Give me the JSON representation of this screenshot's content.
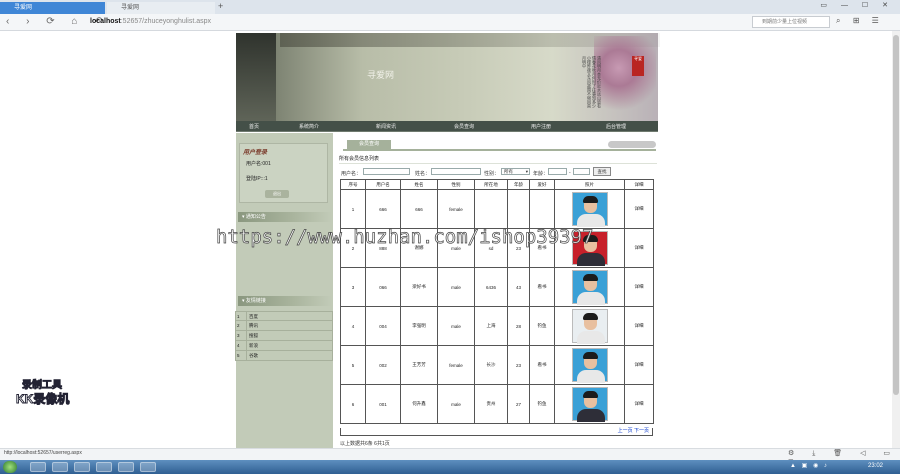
{
  "browser": {
    "tabs": [
      {
        "label": "寻爱网",
        "active": true
      },
      {
        "label": "寻爱网",
        "active": false
      }
    ],
    "new_tab_glyph": "+",
    "window_buttons": "▭ — ☐ ✕",
    "nav_glyphs": "‹ › ⟳ ⌂ ↶",
    "url_host": "localhost",
    "url_path": ":52657/zhuceyonghulist.aspx",
    "search_placeholder": "到期前少量上位视频",
    "right_icons": "⌕ ⊞ ☰"
  },
  "site": {
    "title": "寻爱网",
    "poem": "清风明月本无价近水远山皆有情春花秋月何时了往事知多少小楼昨夜又东风故国不堪回首月明中",
    "seal": "寻爱",
    "nav": [
      "首页",
      "系统简介",
      "新闻资讯",
      "会员查询",
      "用户注册",
      "后台管理"
    ]
  },
  "sidebar": {
    "login_title": "用户登录",
    "user_line": "用户名:001",
    "ip_line": "登陆IP:::1",
    "logout_label": "退出",
    "notice_head": "通知公告",
    "links_head": "友情链接",
    "links": [
      {
        "n": "1",
        "t": "百度"
      },
      {
        "n": "2",
        "t": "腾讯"
      },
      {
        "n": "3",
        "t": "搜狐"
      },
      {
        "n": "4",
        "t": "新浪"
      },
      {
        "n": "5",
        "t": "谷歌"
      }
    ]
  },
  "main": {
    "tab_label": "会员查询",
    "list_title": "所有会员信息列表",
    "filter": {
      "username_label": "用户名：",
      "name_label": "姓名：",
      "sex_label": "性别：",
      "sex_value": "所有",
      "age_label": "年龄：",
      "age_sep": "-",
      "search_label": "查找"
    },
    "columns": [
      "序号",
      "用户名",
      "姓名",
      "性别",
      "所在地",
      "年龄",
      "爱好",
      "照片",
      "详细"
    ],
    "rows": [
      {
        "no": "1",
        "user": "666",
        "name": "666",
        "sex": "female",
        "loc": "",
        "age": "",
        "hobby": "",
        "detail": "详细"
      },
      {
        "no": "2",
        "user": "888",
        "name": "谢娜",
        "sex": "male",
        "loc": "sd",
        "age": "23",
        "hobby": "看书",
        "detail": "详细"
      },
      {
        "no": "3",
        "user": "066",
        "name": "梁好书",
        "sex": "male",
        "loc": "6436",
        "age": "43",
        "hobby": "看书",
        "detail": "详细"
      },
      {
        "no": "4",
        "user": "004",
        "name": "李强明",
        "sex": "male",
        "loc": "上海",
        "age": "28",
        "hobby": "钓鱼",
        "detail": "详细"
      },
      {
        "no": "5",
        "user": "002",
        "name": "王芳芳",
        "sex": "female",
        "loc": "长沙",
        "age": "23",
        "hobby": "看书",
        "detail": "详细"
      },
      {
        "no": "6",
        "user": "001",
        "name": "何升鑫",
        "sex": "male",
        "loc": "贵州",
        "age": "27",
        "hobby": "钓鱼",
        "detail": "详细"
      }
    ],
    "pager": "上一页 下一页",
    "footer_count": "以上数据共6条 6共1页"
  },
  "watermark": {
    "center": "https://www.huzhan.com/ishop39397",
    "logo_line1": "录制工具",
    "logo_line2": "KK录像机"
  },
  "status": {
    "url": "http://localhost:52657/userreg.aspx",
    "icons": "⚙ ⤓ 🗑 ◁ ▭ ⊡",
    "tray": "▲ ▣ ◉ ♪",
    "clock": "23:02"
  },
  "colors": {
    "nav_bg": "#445048",
    "sidebar_bg": "#c2cbb8",
    "tab_active": "#3f86d6",
    "link": "#0033cc"
  }
}
